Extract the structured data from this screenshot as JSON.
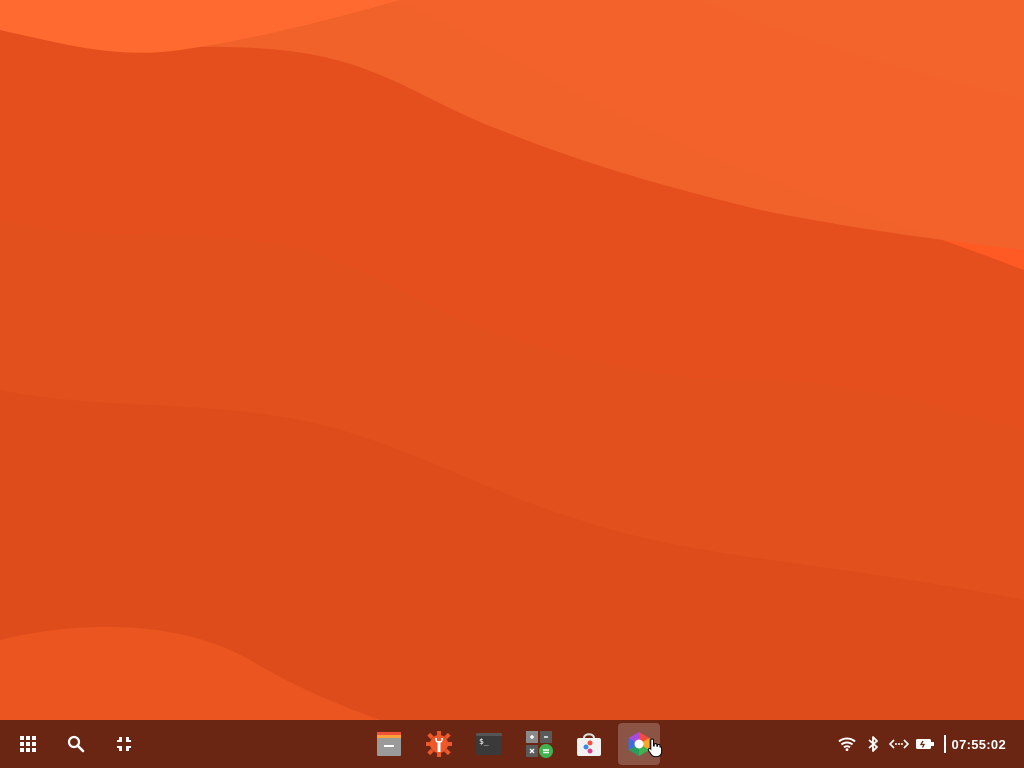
{
  "desktop": {
    "colors": {
      "base": "#e8521f",
      "wave_light": "#f06a3a",
      "wave_dark": "#d8451a",
      "taskbar": "#6b2613"
    }
  },
  "taskbar": {
    "left_buttons": [
      {
        "name": "app-grid",
        "icon": "grid-icon"
      },
      {
        "name": "search",
        "icon": "search-icon"
      },
      {
        "name": "workspaces",
        "icon": "workspace-icon"
      }
    ],
    "apps": [
      {
        "name": "files",
        "icon": "files-icon",
        "active": false
      },
      {
        "name": "settings",
        "icon": "settings-icon",
        "active": false
      },
      {
        "name": "terminal",
        "icon": "terminal-icon",
        "active": false,
        "glyph": "$_"
      },
      {
        "name": "calculator",
        "icon": "calculator-icon",
        "active": false
      },
      {
        "name": "app-store",
        "icon": "app-store-icon",
        "active": false
      },
      {
        "name": "browser",
        "icon": "browser-icon",
        "active": true
      }
    ],
    "tray": {
      "icons": [
        "wifi-icon",
        "bluetooth-icon",
        "network-icon",
        "battery-icon"
      ],
      "clock": "07:55:02"
    }
  }
}
